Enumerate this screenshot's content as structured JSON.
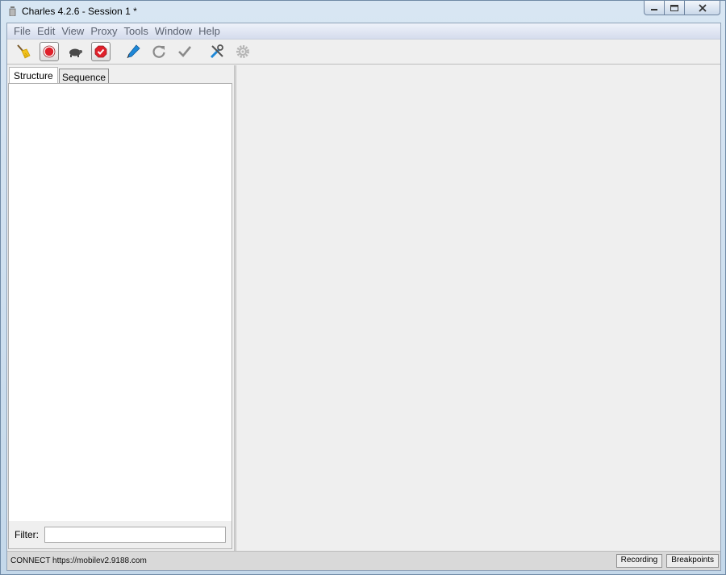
{
  "window": {
    "title": "Charles 4.2.6 - Session 1 *"
  },
  "menu": {
    "items": [
      "File",
      "Edit",
      "View",
      "Proxy",
      "Tools",
      "Window",
      "Help"
    ]
  },
  "toolbar": {
    "buttons": [
      {
        "icon": "broom-icon"
      },
      {
        "icon": "record-icon",
        "pressed": true
      },
      {
        "icon": "turtle-icon"
      },
      {
        "icon": "breakpoints-icon",
        "pressed": true
      },
      {
        "icon": "compose-pen-icon"
      },
      {
        "icon": "refresh-icon"
      },
      {
        "icon": "checkmark-icon"
      },
      {
        "icon": "tools-icon"
      },
      {
        "icon": "settings-gear-icon"
      }
    ]
  },
  "left_pane": {
    "tabs": [
      {
        "label": "Structure",
        "active": true
      },
      {
        "label": "Sequence",
        "active": false
      }
    ],
    "filter": {
      "label": "Filter:",
      "value": ""
    }
  },
  "statusbar": {
    "text": "CONNECT https://mobilev2.9188.com",
    "recording_label": "Recording",
    "breakpoints_label": "Breakpoints"
  },
  "colors": {
    "record_red": "#e0202a",
    "accent_blue": "#1e88d8"
  }
}
